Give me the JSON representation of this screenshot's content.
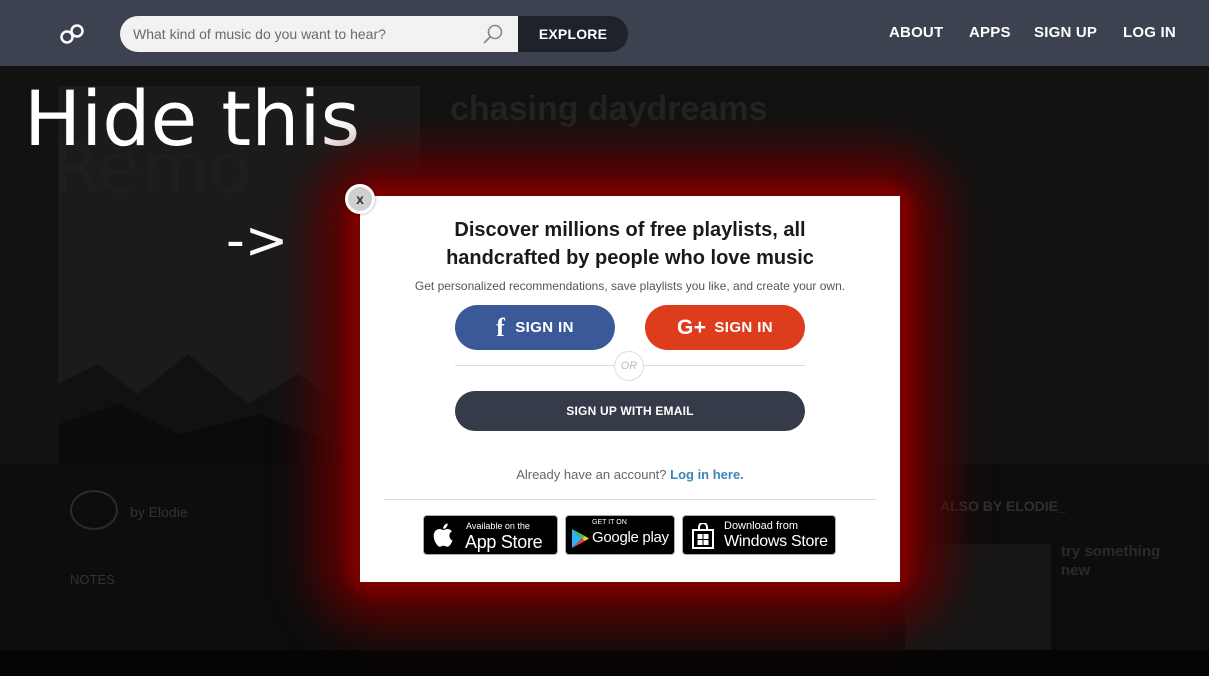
{
  "nav": {
    "search_placeholder": "What kind of music do you want to hear?",
    "explore_label": "EXPLORE",
    "links": [
      "ABOUT",
      "APPS",
      "SIGN UP",
      "LOG IN"
    ]
  },
  "background": {
    "playlist_title": "chasing daydreams",
    "by_label": "by Elodie",
    "notes_label": "NOTES",
    "side_heading": "ALSO BY ELODIE_",
    "side_item_title": "try something new"
  },
  "annotation": {
    "hide_text": "Hide this",
    "overlay_text": "Remo",
    "arrow_text": "->"
  },
  "modal": {
    "close_label": "x",
    "title_line1": "Discover millions of free playlists, all",
    "title_line2": "handcrafted by people who love music",
    "subtitle": "Get personalized recommendations, save playlists you like, and create your own.",
    "facebook_label": "SIGN IN",
    "google_label": "SIGN IN",
    "or_label": "OR",
    "email_label": "SIGN UP WITH EMAIL",
    "account_text": "Already have an account?",
    "login_link": "Log in here.",
    "stores": {
      "apple_small": "Available on the",
      "apple_big": "App Store",
      "google_small": "GET IT ON",
      "google_big": "Google play",
      "windows_small": "Download from",
      "windows_big": "Windows Store"
    }
  },
  "colors": {
    "nav_bg": "#3c4250",
    "facebook": "#3b5998",
    "google": "#dd3d1c",
    "email_button": "#363b49",
    "link": "#3a86b8",
    "glow": "#7a0000"
  }
}
